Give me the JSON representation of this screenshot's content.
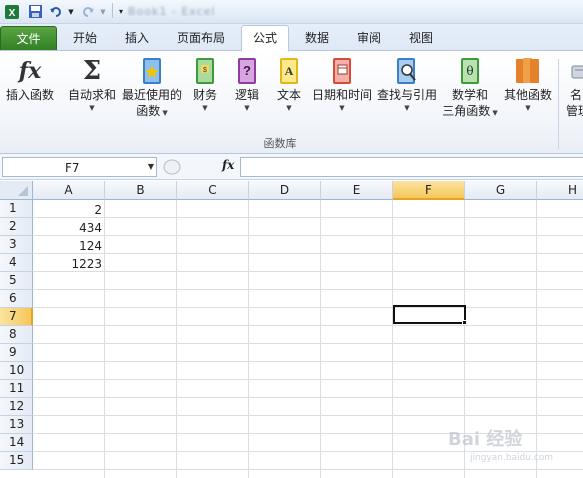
{
  "titlebar": {
    "doc_title": "Book1 - Excel"
  },
  "tabs": [
    {
      "label": "文件"
    },
    {
      "label": "开始"
    },
    {
      "label": "插入"
    },
    {
      "label": "页面布局"
    },
    {
      "label": "公式"
    },
    {
      "label": "数据"
    },
    {
      "label": "审阅"
    },
    {
      "label": "视图"
    }
  ],
  "ribbon": {
    "buttons": [
      {
        "label": "插入函数",
        "label2": "",
        "icon": "fx-icon"
      },
      {
        "label": "自动求和",
        "label2": "",
        "icon": "sigma-icon"
      },
      {
        "label": "最近使用的",
        "label2": "函数",
        "icon": "book-star-icon"
      },
      {
        "label": "财务",
        "label2": "",
        "icon": "book-finance-icon"
      },
      {
        "label": "逻辑",
        "label2": "",
        "icon": "book-logic-icon"
      },
      {
        "label": "文本",
        "label2": "",
        "icon": "book-text-icon"
      },
      {
        "label": "日期和时间",
        "label2": "",
        "icon": "book-date-icon"
      },
      {
        "label": "查找与引用",
        "label2": "",
        "icon": "book-lookup-icon"
      },
      {
        "label": "数学和",
        "label2": "三角函数",
        "icon": "book-math-icon"
      },
      {
        "label": "其他函数",
        "label2": "",
        "icon": "book-other-icon"
      },
      {
        "label": "名",
        "label2": "管理",
        "icon": "name-manager-icon"
      }
    ],
    "group_label": "函数库",
    "colors": {
      "book_blue": "#3a7fc8",
      "book_green": "#3f9a3a",
      "book_purple": "#8e3c9e",
      "book_yellow": "#e3b719",
      "book_red": "#d64a3a",
      "book_orange": "#e3822a"
    }
  },
  "formula_bar": {
    "name_box": "F7",
    "fx": "fx",
    "formula": ""
  },
  "sheet": {
    "columns": [
      "A",
      "B",
      "C",
      "D",
      "E",
      "F",
      "G",
      "H"
    ],
    "selected_column": "F",
    "rows": [
      "1",
      "2",
      "3",
      "4",
      "5",
      "6",
      "7",
      "8",
      "9",
      "10",
      "11",
      "12",
      "13",
      "14",
      "15"
    ],
    "selected_row": "7",
    "column_a_values": [
      "2",
      "434",
      "124",
      "1223"
    ]
  },
  "watermark": {
    "text": "Bai 经验",
    "sub": "jingyan.baidu.com"
  }
}
